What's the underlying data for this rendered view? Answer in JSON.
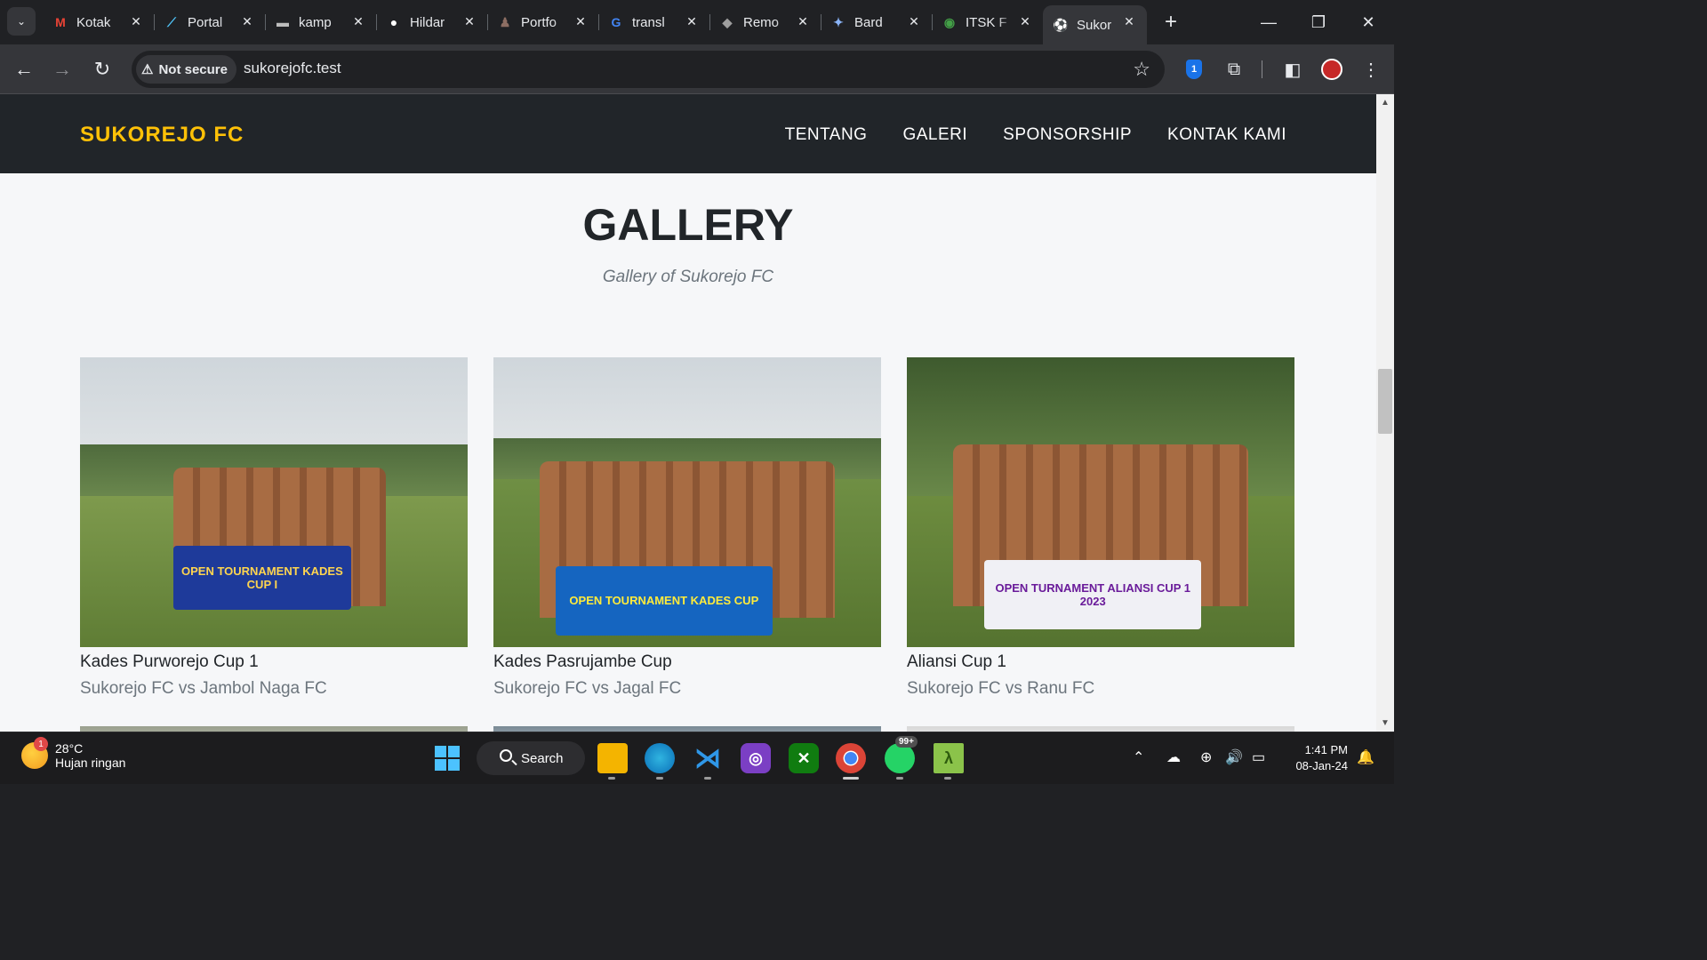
{
  "browser": {
    "tabs": [
      {
        "title": "Kotak",
        "icon": "gmail-icon",
        "color": "#ea4335",
        "glyph": "M"
      },
      {
        "title": "Portal",
        "icon": "portal-icon",
        "color": "#4fc3f7",
        "glyph": "⟋"
      },
      {
        "title": "kamp",
        "icon": "kampus-icon",
        "color": "#bdbdbd",
        "glyph": "▬"
      },
      {
        "title": "Hildar",
        "icon": "github-icon",
        "color": "#ffffff",
        "glyph": "●"
      },
      {
        "title": "Portfo",
        "icon": "portfolio-icon",
        "color": "#8d6e63",
        "glyph": "♟"
      },
      {
        "title": "transl",
        "icon": "google-icon",
        "color": "#4285f4",
        "glyph": "G"
      },
      {
        "title": "Remo",
        "icon": "remote-icon",
        "color": "#9e9e9e",
        "glyph": "◆"
      },
      {
        "title": "Bard",
        "icon": "bard-icon",
        "color": "#8ab4f8",
        "glyph": "✦"
      },
      {
        "title": "ITSK F",
        "icon": "itsk-icon",
        "color": "#43a047",
        "glyph": "◉"
      },
      {
        "title": "Sukor",
        "icon": "sukorejo-icon",
        "color": "#aaaaaa",
        "glyph": "⚽"
      }
    ],
    "active_tab": 9,
    "security_label": "Not secure",
    "url": "sukorejofc.test"
  },
  "site": {
    "brand": "SUKOREJO FC",
    "brand_color": "#ffc107",
    "nav": [
      "TENTANG",
      "GALERI",
      "SPONSORSHIP",
      "KONTAK KAMI"
    ],
    "section_title": "GALLERY",
    "section_subtitle": "Gallery of Sukorejo FC",
    "gallery": [
      {
        "title": "Kades Purworejo Cup 1",
        "match": "Sukorejo FC vs Jambol Naga FC",
        "banner": "OPEN TOURNAMENT KADES CUP I",
        "banner_color": "#1e3a9a"
      },
      {
        "title": "Kades Pasrujambe Cup",
        "match": "Sukorejo FC vs Jagal FC",
        "banner": "OPEN TOURNAMENT KADES CUP",
        "banner_color": "#1565c0"
      },
      {
        "title": "Aliansi Cup 1",
        "match": "Sukorejo FC vs Ranu FC",
        "banner": "OPEN TURNAMENT ALIANSI CUP 1 2023",
        "banner_color": "#f0f0f5"
      }
    ]
  },
  "taskbar": {
    "weather_temp": "28°C",
    "weather_cond": "Hujan ringan",
    "weather_badge": "1",
    "search_label": "Search",
    "whatsapp_badge": "99+",
    "time": "1:41 PM",
    "date": "08-Jan-24"
  }
}
